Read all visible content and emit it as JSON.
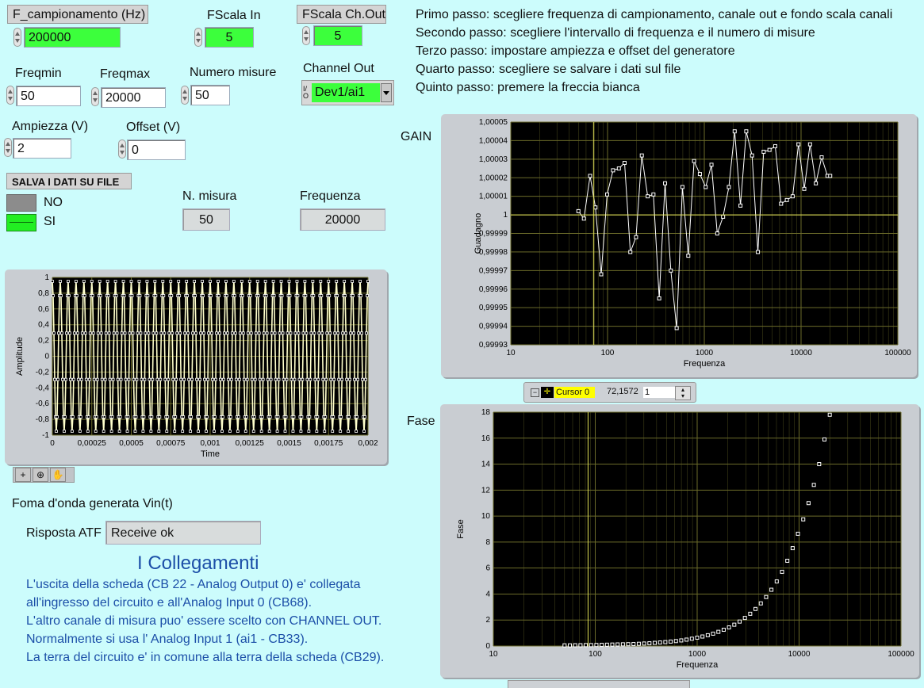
{
  "controls": {
    "f_camp": {
      "label": "F_campionamento (Hz)",
      "value": "200000"
    },
    "fscala_in": {
      "label": "FScala In",
      "value": "5"
    },
    "fscala_out": {
      "label": "FScala Ch.Out",
      "value": "5"
    },
    "freqmin": {
      "label": "Freqmin",
      "value": "50"
    },
    "freqmax": {
      "label": "Freqmax",
      "value": "20000"
    },
    "nmisure": {
      "label": "Numero misure",
      "value": "50"
    },
    "channel": {
      "label": "Channel Out",
      "value": "Dev1/ai1",
      "prefix": "I/O"
    },
    "ampiezza": {
      "label": "Ampiezza (V)",
      "value": "2"
    },
    "offset": {
      "label": "Offset (V)",
      "value": "0"
    },
    "salva": {
      "label": "SALVA I DATI SU FILE",
      "no": "NO",
      "si": "SI"
    },
    "nmisura": {
      "label": "N. misura",
      "value": "50"
    },
    "frequenza": {
      "label": "Frequenza",
      "value": "20000"
    },
    "risposta": {
      "label": "Risposta ATF",
      "value": "Receive ok"
    }
  },
  "instructions": [
    "Primo passo: scegliere frequenza di campionamento, canale out e fondo scala canali",
    "Secondo passo: scegliere l'intervallo di frequenza e il numero di misure",
    "Terzo passo: impostare ampiezza e offset del generatore",
    "Quarto passo: scegliere se salvare i dati sul file",
    "Quinto passo: premere la freccia bianca"
  ],
  "wave_caption": "Foma d'onda generata Vin(t)",
  "collegamenti": {
    "title": "I Collegamenti",
    "lines": [
      "L'uscita della scheda (CB 22 - Analog Output 0) e' collegata",
      "all'ingresso del circuito e all'Analog Input 0 (CB68).",
      "L'altro canale di misura puo' essere scelto con CHANNEL OUT.",
      "Normalmente si usa l' Analog Input 1 (ai1 - CB33).",
      "La terra del circuito e' in comune alla terra della scheda (CB29)."
    ]
  },
  "gain_label": "GAIN",
  "fase_label": "Fase",
  "cursor": {
    "name": "Cursor 0",
    "x": "72,1572",
    "y": "1"
  },
  "colors": {
    "background": "#ccfcfc",
    "green": "#3cff3c",
    "plot": "#000000",
    "grid": "#6b6b2a",
    "trace": "#ffffff",
    "cursor": "#e6e65a"
  },
  "chart_data": [
    {
      "type": "line",
      "name": "waveform",
      "xlabel": "Time",
      "ylabel": "Amplitude",
      "xlim": [
        0,
        0.002
      ],
      "ylim": [
        -1,
        1
      ],
      "x_ticks": [
        "0",
        "0,00025",
        "0,0005",
        "0,00075",
        "0,001",
        "0,00125",
        "0,0015",
        "0,00175",
        "0,002"
      ],
      "y_ticks": [
        "1",
        "0,8",
        "0,6",
        "0,4",
        "0,2",
        "0",
        "-0,2",
        "-0,4",
        "-0,6",
        "-0,8",
        "-1"
      ],
      "signal": {
        "frequency_hz": 20000,
        "amplitude": 0.95,
        "sample_rate_hz": 200000
      }
    },
    {
      "type": "scatter",
      "name": "gain",
      "xlabel": "Frequenza",
      "ylabel": "Guadagno",
      "x_scale": "log",
      "xlim": [
        10,
        100000
      ],
      "ylim": [
        0.99993,
        1.00005
      ],
      "x_ticks": [
        "10",
        "100",
        "1000",
        "10000",
        "100000"
      ],
      "y_ticks": [
        "1,00005",
        "1,00004",
        "1,00003",
        "1,00002",
        "1,00001",
        "1",
        "0,99999",
        "0,99998",
        "0,99997",
        "0,99996",
        "0,99995",
        "0,99994",
        "0,99993"
      ],
      "x": [
        50,
        57,
        66,
        75,
        86,
        99,
        114,
        131,
        150,
        172,
        197,
        226,
        260,
        298,
        342,
        393,
        451,
        518,
        594,
        683,
        784,
        900,
        1033,
        1186,
        1361,
        1563,
        1794,
        2060,
        2365,
        2714,
        3116,
        3578,
        4107,
        4715,
        5412,
        6213,
        7132,
        8187,
        9398,
        10789,
        12385,
        14218,
        16321,
        18736,
        20000
      ],
      "values": [
        1.000002,
        0.999998,
        1.000021,
        1.000004,
        0.999968,
        1.000011,
        1.000024,
        1.000025,
        1.000028,
        0.99998,
        0.999988,
        1.000032,
        1.00001,
        1.000011,
        0.999955,
        1.000017,
        0.99997,
        0.999939,
        1.000015,
        0.999978,
        1.000029,
        1.000022,
        1.000015,
        1.000027,
        0.99999,
        0.999999,
        1.000015,
        1.000045,
        1.000005,
        1.000045,
        1.000032,
        0.99998,
        1.000034,
        1.000035,
        1.000037,
        1.000006,
        1.000008,
        1.00001,
        1.000038,
        1.000014,
        1.000038,
        1.000017,
        1.000031,
        1.000021,
        1.000021,
        1.00004,
        1.000016,
        1.000007,
        1.000034,
        1.000008
      ],
      "cursor_x": 72.1572
    },
    {
      "type": "scatter",
      "name": "phase",
      "xlabel": "Frequenza",
      "ylabel": "Fase",
      "x_scale": "log",
      "xlim": [
        10,
        100000
      ],
      "ylim": [
        0,
        18
      ],
      "x_ticks": [
        "10",
        "100",
        "1000",
        "10000",
        "100000"
      ],
      "y_ticks": [
        "18",
        "16",
        "14",
        "12",
        "10",
        "8",
        "6",
        "4",
        "2",
        "0"
      ],
      "values": [
        0.05,
        0.05,
        0.06,
        0.06,
        0.07,
        0.07,
        0.08,
        0.09,
        0.1,
        0.11,
        0.12,
        0.13,
        0.14,
        0.15,
        0.17,
        0.19,
        0.21,
        0.24,
        0.27,
        0.3,
        0.34,
        0.38,
        0.43,
        0.49,
        0.56,
        0.64,
        0.73,
        0.83,
        0.95,
        1.09,
        1.25,
        1.43,
        1.64,
        1.88,
        2.16,
        2.48,
        2.85,
        3.28,
        3.77,
        4.33,
        4.97,
        5.71,
        6.56,
        7.53,
        8.64,
        9.75,
        11.0,
        12.4,
        14.0,
        15.9,
        17.8
      ],
      "cursor_x": 85
    }
  ]
}
